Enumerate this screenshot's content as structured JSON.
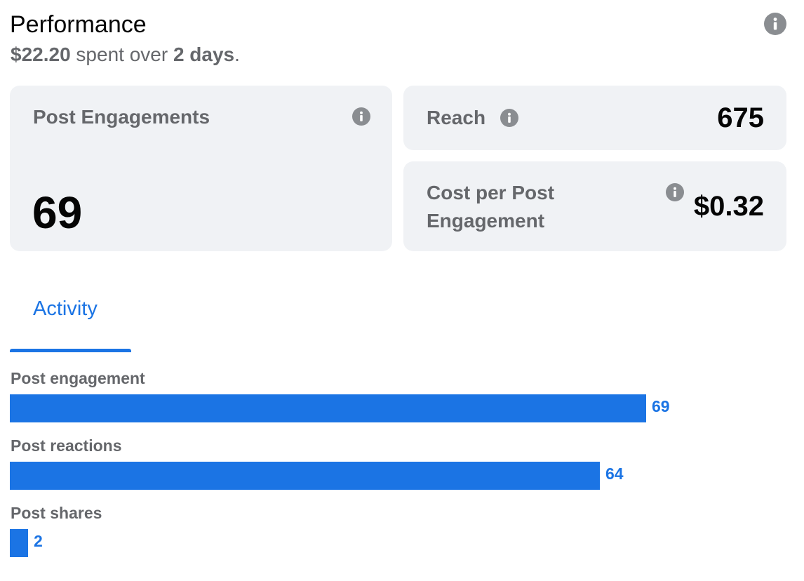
{
  "header": {
    "title": "Performance",
    "spent_amount": "$22.20",
    "spent_text": "spent over",
    "days": "2 days",
    "period_suffix": "."
  },
  "cards": {
    "post_engagements": {
      "label": "Post Engagements",
      "value": "69"
    },
    "reach": {
      "label": "Reach",
      "value": "675"
    },
    "cost_per_engagement": {
      "label_line1": "Cost per Post",
      "label_line2": "Engagement",
      "value": "$0.32"
    }
  },
  "tabs": [
    {
      "label": "Activity",
      "active": true
    }
  ],
  "activity": {
    "max_value": 69,
    "metrics": [
      {
        "label": "Post engagement",
        "value": 69
      },
      {
        "label": "Post reactions",
        "value": 64
      },
      {
        "label": "Post shares",
        "value": 2
      }
    ]
  },
  "icons": {
    "info": "info-icon"
  },
  "colors": {
    "accent": "#1b74e4",
    "card_bg": "#f0f2f5",
    "muted_text": "#65676b",
    "icon_gray": "#8a8d91"
  }
}
